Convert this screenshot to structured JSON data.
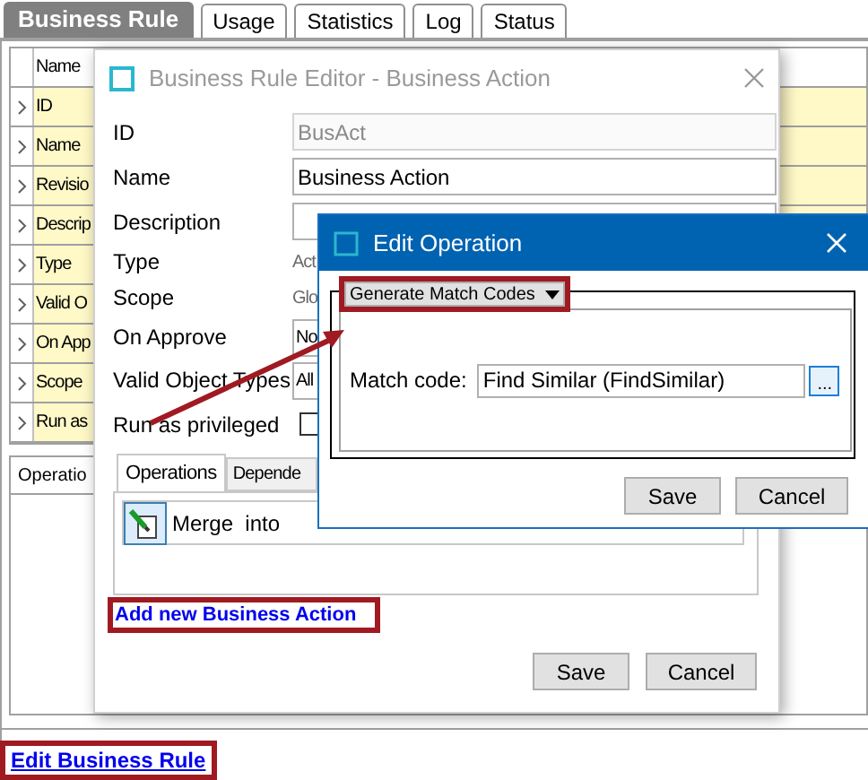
{
  "tabs": [
    {
      "label": "Business Rule",
      "selected": true
    },
    {
      "label": "Usage",
      "selected": false
    },
    {
      "label": "Statistics",
      "selected": false
    },
    {
      "label": "Log",
      "selected": false
    },
    {
      "label": "Status",
      "selected": false
    }
  ],
  "table": {
    "columns": [
      "Name"
    ],
    "rows": [
      {
        "name": "ID"
      },
      {
        "name": "Name"
      },
      {
        "name": "Revisio"
      },
      {
        "name": "Descrip"
      },
      {
        "name": "Type"
      },
      {
        "name": "Valid O"
      },
      {
        "name": "On App"
      },
      {
        "name": "Scope"
      },
      {
        "name": "Run as"
      }
    ]
  },
  "bottom_tabs": [
    {
      "label": "Operatio",
      "selected": true
    }
  ],
  "edit_link": "Edit Business Rule",
  "editor": {
    "title": "Business Rule Editor - Business Action",
    "fields": [
      {
        "kind": "input",
        "label": "ID",
        "value": "BusAct",
        "disabled": true
      },
      {
        "kind": "input",
        "label": "Name",
        "value": "Business Action",
        "disabled": false
      },
      {
        "kind": "input",
        "label": "Description"
      },
      {
        "kind": "text",
        "label": "Type",
        "value": "Act"
      },
      {
        "kind": "text",
        "label": "Scope",
        "value": "Glo"
      },
      {
        "kind": "select",
        "label": "On Approve",
        "value": "No"
      },
      {
        "kind": "select",
        "label": "Valid Object Types",
        "value": "All"
      },
      {
        "kind": "checkbox",
        "label": "Run as privileged",
        "checked": false
      }
    ],
    "tabs": [
      {
        "label": "Operations",
        "selected": true
      },
      {
        "label": "Depende",
        "selected": false
      }
    ],
    "operations": [
      {
        "label": "Merge  into"
      }
    ],
    "add_link": "Add new Business Action",
    "buttons": [
      "Save",
      "Cancel"
    ]
  },
  "edit_operation": {
    "title": "Edit Operation",
    "dropdown": "Generate Match Codes",
    "field_label": "Match code:",
    "value": "Find Similar (FindSimilar)",
    "browse": "...",
    "buttons": [
      "Save",
      "Cancel"
    ]
  }
}
